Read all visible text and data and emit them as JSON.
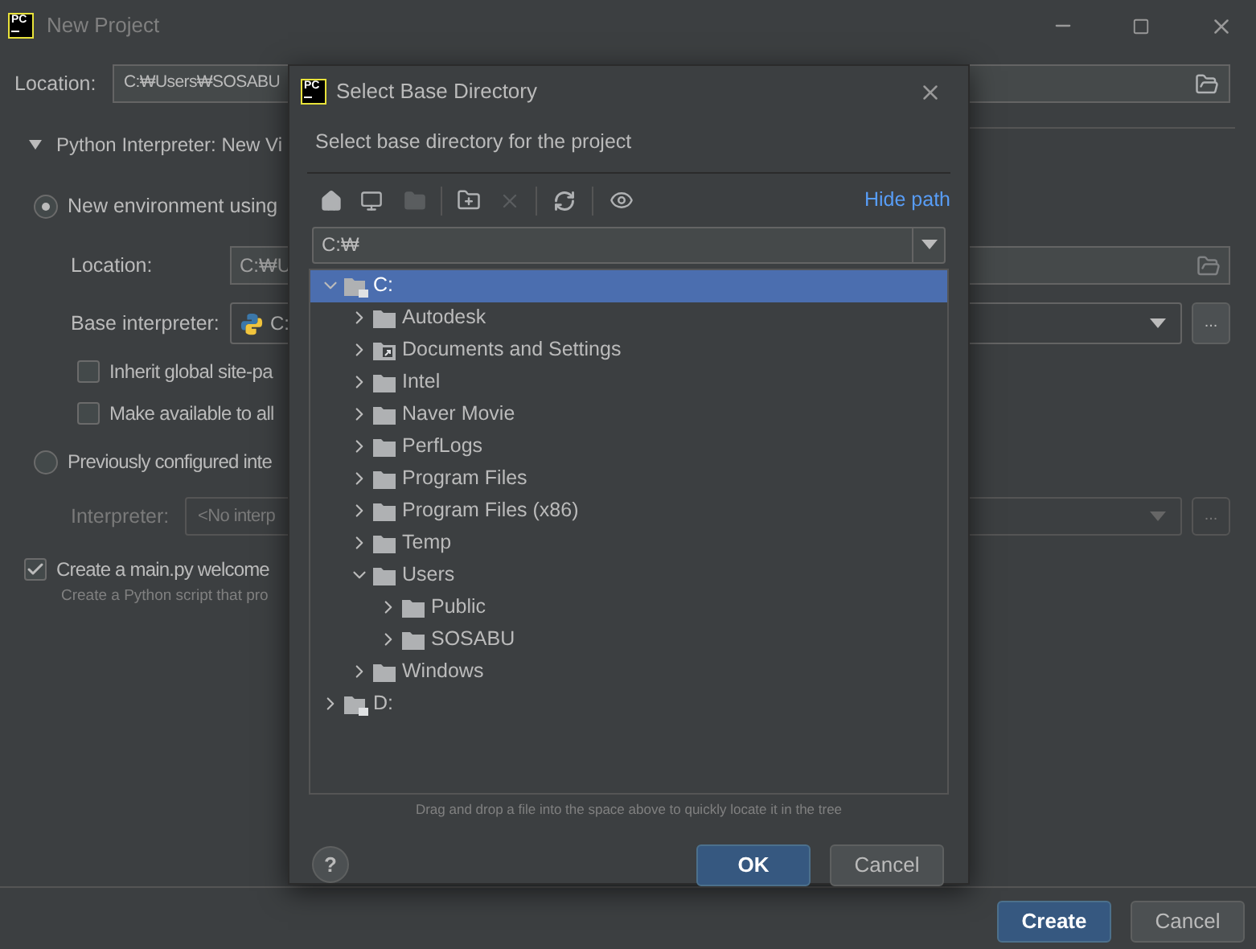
{
  "window": {
    "logo": "PC",
    "title": "New Project"
  },
  "location": {
    "label": "Location:",
    "value": "C:₩Users₩SOSABU"
  },
  "interpreter_section": {
    "title": "Python Interpreter: New Vi",
    "expanded": true
  },
  "new_environment": {
    "label": "New environment using",
    "selected": true,
    "location": {
      "label": "Location:",
      "value": "C:₩U"
    },
    "base_interpreter": {
      "label": "Base interpreter:",
      "value": "C:",
      "more": "..."
    },
    "checkboxes": [
      {
        "label": "Inherit global site-pa",
        "checked": false
      },
      {
        "label": "Make available to all",
        "checked": false
      }
    ]
  },
  "previous": {
    "label": "Previously configured inte",
    "selected": false,
    "interpreter": {
      "label": "Interpreter:",
      "placeholder": "<No interp",
      "more": "..."
    }
  },
  "welcome_script": {
    "label": "Create a main.py welcome",
    "checked": true,
    "hint": "Create a Python script that pro"
  },
  "buttons": [
    {
      "label": "Create",
      "primary": true
    },
    {
      "label": "Cancel",
      "primary": false
    }
  ],
  "dialog": {
    "logo": "PC",
    "title": "Select Base Directory",
    "description": "Select base directory for the project",
    "hide_path": "Hide path",
    "path": "C:₩",
    "tree": [
      {
        "name": "C:",
        "kind": "drive",
        "expanded": true,
        "selected": true,
        "children": [
          {
            "name": "Autodesk",
            "kind": "folder",
            "expanded": false,
            "selected": false
          },
          {
            "name": "Documents and Settings",
            "kind": "link",
            "expanded": false,
            "selected": false
          },
          {
            "name": "Intel",
            "kind": "folder",
            "expanded": false,
            "selected": false
          },
          {
            "name": "Naver Movie",
            "kind": "folder",
            "expanded": false,
            "selected": false
          },
          {
            "name": "PerfLogs",
            "kind": "folder",
            "expanded": false,
            "selected": false
          },
          {
            "name": "Program Files",
            "kind": "folder",
            "expanded": false,
            "selected": false
          },
          {
            "name": "Program Files (x86)",
            "kind": "folder",
            "expanded": false,
            "selected": false
          },
          {
            "name": "Temp",
            "kind": "folder",
            "expanded": false,
            "selected": false
          },
          {
            "name": "Users",
            "kind": "folder",
            "expanded": true,
            "selected": false,
            "children": [
              {
                "name": "Public",
                "kind": "folder",
                "expanded": false,
                "selected": false
              },
              {
                "name": "SOSABU",
                "kind": "folder",
                "expanded": false,
                "selected": false
              }
            ]
          },
          {
            "name": "Windows",
            "kind": "folder",
            "expanded": false,
            "selected": false
          }
        ]
      },
      {
        "name": "D:",
        "kind": "drive",
        "expanded": false,
        "selected": false
      }
    ],
    "hint": "Drag and drop a file into the space above to quickly locate it in the tree",
    "help": "?",
    "buttons": [
      {
        "label": "OK",
        "primary": true
      },
      {
        "label": "Cancel",
        "primary": false
      }
    ]
  }
}
